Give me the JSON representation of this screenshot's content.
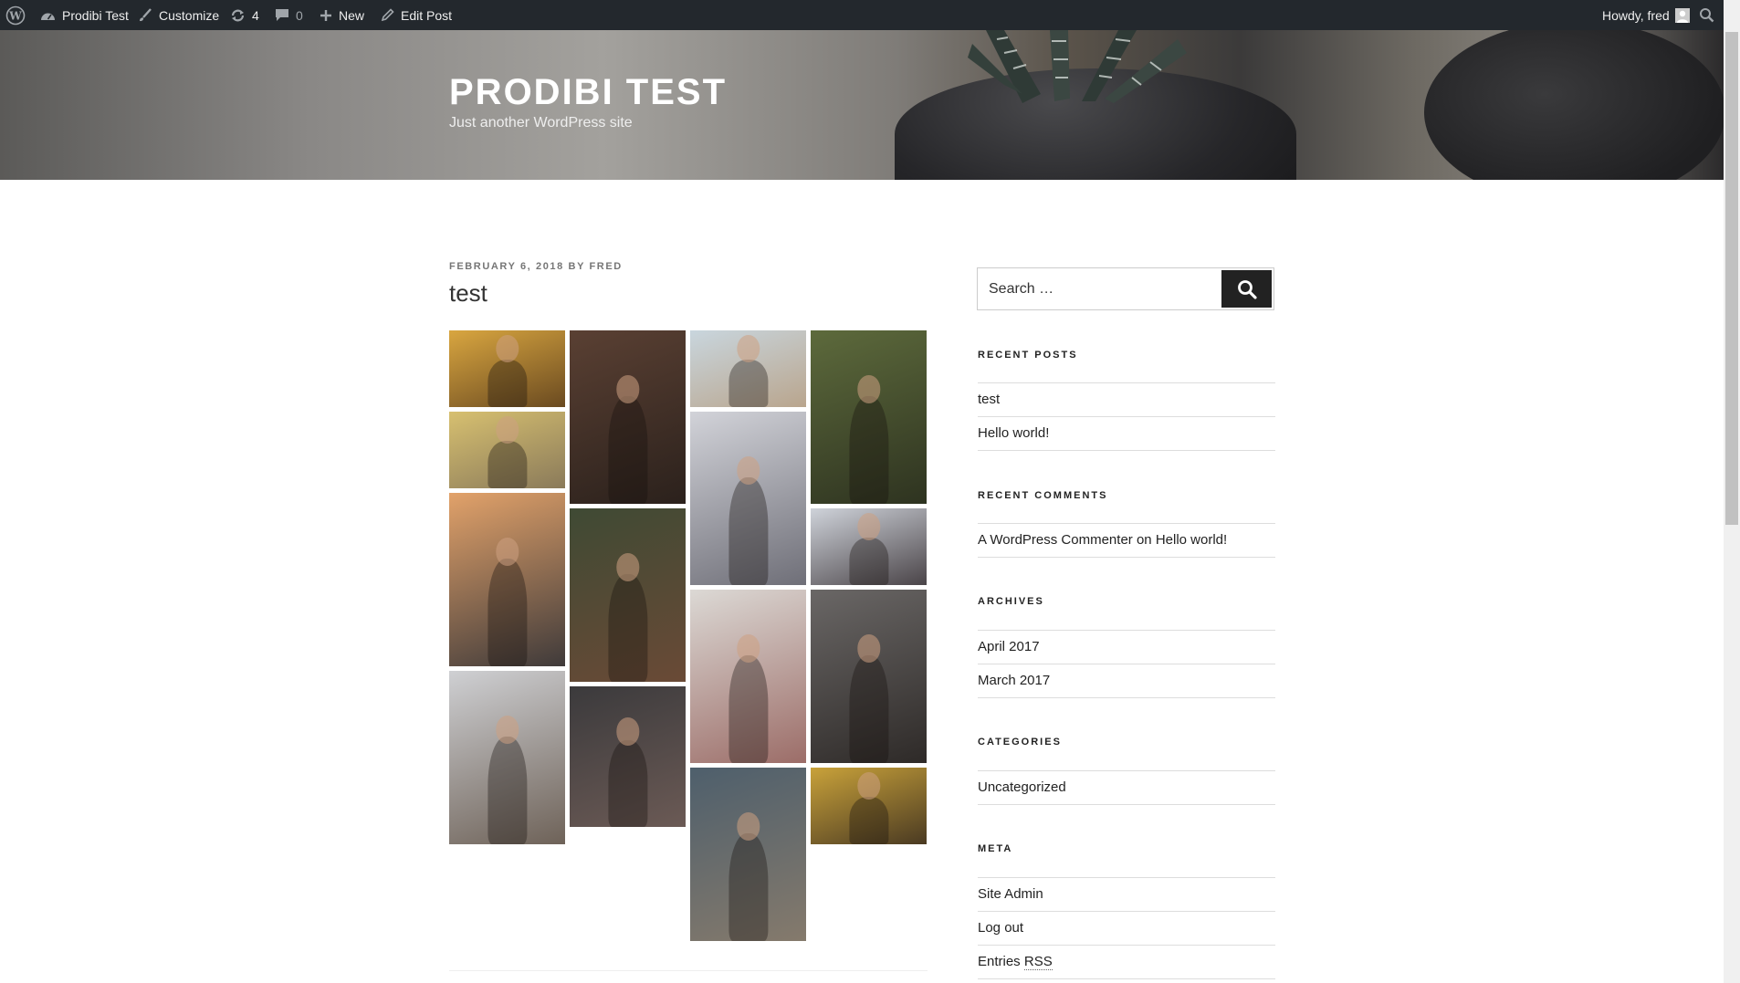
{
  "admin_bar": {
    "site_name": "Prodibi Test",
    "customize": "Customize",
    "updates_count": "4",
    "comments_count": "0",
    "new_label": "New",
    "edit_post": "Edit Post",
    "howdy": "Howdy, fred"
  },
  "header": {
    "site_title": "PRODIBI TEST",
    "tagline": "Just another WordPress site"
  },
  "post": {
    "date": "FEBRUARY 6, 2018",
    "by": "BY",
    "author": "FRED",
    "title": "test",
    "gallery": [
      {
        "label": "woman in golden field at sunset",
        "colors": [
          "#d9a640",
          "#6a4a20"
        ]
      },
      {
        "label": "woman in plaid shirt with string lights",
        "colors": [
          "#5a4033",
          "#2b211c"
        ]
      },
      {
        "label": "woman with flower crown at beach",
        "colors": [
          "#c9d6de",
          "#b9a58d"
        ]
      },
      {
        "label": "woman among green leaves",
        "colors": [
          "#5d6a3c",
          "#2e3320"
        ]
      },
      {
        "label": "blonde woman against yellow wall",
        "colors": [
          "#d7c070",
          "#8a7a5a"
        ]
      },
      {
        "label": "woman on beach holding blanket",
        "colors": [
          "#d2d3d9",
          "#6f6f78"
        ]
      },
      {
        "label": "woman in beanie with scarf",
        "colors": [
          "#cfd3da",
          "#4a4448"
        ]
      },
      {
        "label": "woman sitting on shore at sunset",
        "colors": [
          "#e2a26a",
          "#3f3a3a"
        ]
      },
      {
        "label": "curly haired woman by christmas tree",
        "colors": [
          "#3f4a34",
          "#6a4a36"
        ]
      },
      {
        "label": "woman at amusement park",
        "colors": [
          "#dcd9d5",
          "#9c6d68"
        ]
      },
      {
        "label": "woman playing guitar",
        "colors": [
          "#6a6766",
          "#2e2a28"
        ]
      },
      {
        "label": "woman walking by ferris wheel",
        "colors": [
          "#cfd0d3",
          "#6e6258"
        ]
      },
      {
        "label": "woman with painted face",
        "colors": [
          "#3b3a3c",
          "#6b5a55"
        ]
      },
      {
        "label": "woman sitting on steps by the sea",
        "colors": [
          "#4e5f6c",
          "#857a6c"
        ]
      },
      {
        "label": "hands with bracelets on yellow",
        "colors": [
          "#c9a23a",
          "#4a3a22"
        ]
      }
    ]
  },
  "sidebar": {
    "search_placeholder": "Search …",
    "recent_posts": {
      "title": "RECENT POSTS",
      "items": [
        "test",
        "Hello world!"
      ]
    },
    "recent_comments": {
      "title": "RECENT COMMENTS",
      "author": "A WordPress Commenter",
      "on": "on",
      "post": "Hello world!"
    },
    "archives": {
      "title": "ARCHIVES",
      "items": [
        "April 2017",
        "March 2017"
      ]
    },
    "categories": {
      "title": "CATEGORIES",
      "items": [
        "Uncategorized"
      ]
    },
    "meta": {
      "title": "META",
      "items": [
        "Site Admin",
        "Log out"
      ],
      "entries_prefix": "Entries",
      "entries_abbr": "RSS"
    }
  },
  "colors": {
    "admin_bar_bg": "#23282d",
    "search_button": "#222222",
    "site_title": "#ffffff"
  }
}
